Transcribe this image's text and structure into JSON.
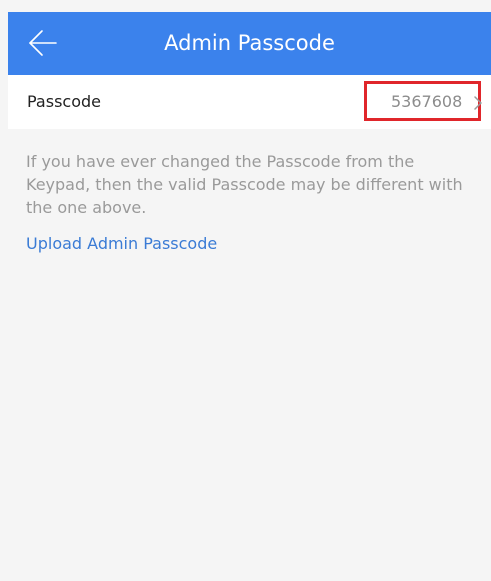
{
  "header": {
    "title": "Admin Passcode",
    "back_icon": "arrow-left-icon",
    "background_color": "#3b82ec"
  },
  "passcode_row": {
    "label": "Passcode",
    "value": "5367608",
    "chevron_icon": "chevron-right-icon",
    "highlight_color": "#e0262b"
  },
  "note": {
    "text": "If you have ever changed the Passcode from the Keypad, then the valid Passcode may be different with the one above."
  },
  "upload_link": {
    "label": "Upload Admin Passcode",
    "color": "#3a7bd5"
  }
}
